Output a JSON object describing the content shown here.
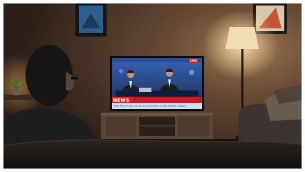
{
  "scene": {
    "description_tags": [
      "living-room",
      "television",
      "news-broadcast",
      "viewer",
      "floor-lamp",
      "sofa"
    ],
    "tv": {
      "badge": "LIVE",
      "banner_label": "NEWS",
      "ticker": "Time flies on fast. El ojo de un tiempo cerrado abierto. Bago b"
    },
    "colors": {
      "wall": "#4a3528",
      "lamp_glow": "#f2d2a0",
      "news_red": "#d6231f",
      "ticker_blue": "#cfe0f5",
      "tv_studio": "#1d3c78"
    }
  }
}
